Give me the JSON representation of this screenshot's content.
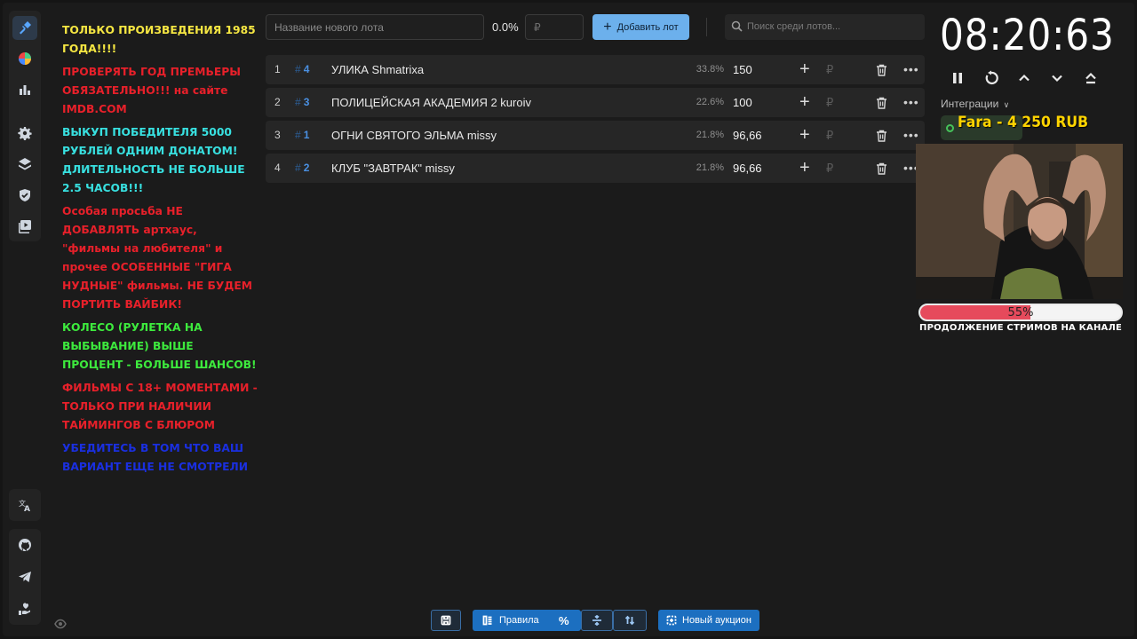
{
  "rules": [
    {
      "text": "ТОЛЬКО ПРОИЗВЕДЕНИЯ 1985 ГОДА!!!!",
      "color": "#f5e642"
    },
    {
      "text": "ПРОВЕРЯТЬ ГОД ПРЕМЬЕРЫ ОБЯЗАТЕЛЬНО!!! на сайте IMDB.COM",
      "color": "#e8202a"
    },
    {
      "text": "ВЫКУП ПОБЕДИТЕЛЯ 5000 РУБЛЕЙ ОДНИМ ДОНАТОМ!",
      "color": "#38e0e0"
    },
    {
      "text": "ДЛИТЕЛЬНОСТЬ НЕ БОЛЬШЕ 2.5 ЧАСОВ!!!",
      "color": "#38e0e0"
    },
    {
      "text": "Особая просьба НЕ ДОБАВЛЯТЬ артхаус, \"фильмы на любителя\" и прочее ОСОБЕННЫЕ \"ГИГА НУДНЫЕ\" фильмы. НЕ БУДЕМ ПОРТИТЬ ВАЙБИК!",
      "color": "#e8202a"
    },
    {
      "text": "КОЛЕСО (РУЛЕТКА НА ВЫБЫВАНИЕ) ВЫШЕ ПРОЦЕНТ - БОЛЬШЕ ШАНСОВ!",
      "color": "#3dea3d"
    },
    {
      "text": "ФИЛЬМЫ С 18+ МОМЕНТАМИ - ТОЛЬКО ПРИ НАЛИЧИИ ТАЙМИНГОВ С БЛЮРОМ",
      "color": "#e8202a"
    },
    {
      "text": "УБЕДИТЕСЬ В ТОМ ЧТО ВАШ ВАРИАНТ ЕЩЕ НЕ СМОТРЕЛИ",
      "color": "#1a2fe0"
    }
  ],
  "toolbar": {
    "lot_name_placeholder": "Название нового лота",
    "percent": "0.0%",
    "amount_placeholder": "₽",
    "add_label": "Добавить лот",
    "search_placeholder": "Поиск среди лотов..."
  },
  "lots": [
    {
      "index": "1",
      "number": "4",
      "title": "УЛИКА Shmatrixa",
      "percent": "33.8%",
      "value": "150"
    },
    {
      "index": "2",
      "number": "3",
      "title": "ПОЛИЦЕЙСКАЯ АКАДЕМИЯ 2 kuroiv",
      "percent": "22.6%",
      "value": "100"
    },
    {
      "index": "3",
      "number": "1",
      "title": "ОГНИ СВЯТОГО ЭЛЬМА missy",
      "percent": "21.8%",
      "value": "96,66"
    },
    {
      "index": "4",
      "number": "2",
      "title": "КЛУБ \"ЗАВТРАК\" missy",
      "percent": "21.8%",
      "value": "96,66"
    }
  ],
  "lot_symbols": {
    "hash": "#",
    "plus": "+",
    "currency": "₽",
    "more": "•••"
  },
  "timer": {
    "display": "08:20:63"
  },
  "integrations": {
    "label": "Интеграции",
    "donation": "Fara - 4 250 RUB"
  },
  "stream_progress": {
    "percent": 55,
    "percent_label": "55%",
    "label": "ПРОДОЛЖЕНИЕ СТРИМОВ НА КАНАЛЕ"
  },
  "bottom_bar": {
    "rules_label": "Правила",
    "percent_symbol": "%",
    "new_auction_label": "Новый аукцион"
  },
  "colors": {
    "accent": "#6cb0ec",
    "button_blue": "#1c6fc0",
    "lot_number": "#4a90e2",
    "progress_fill": "#e64a5c",
    "donation_text": "#ffd400"
  }
}
